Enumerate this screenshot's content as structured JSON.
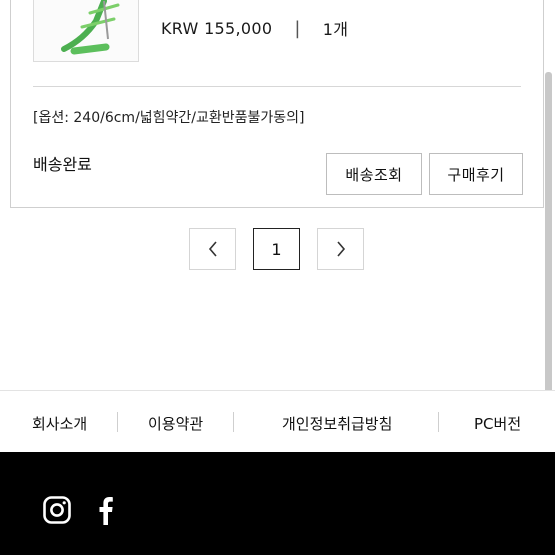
{
  "order": {
    "price": "KRW 155,000",
    "separator": "|",
    "quantity": "1개",
    "option": "[옵션: 240/6cm/넓힘약간/교환반품불가동의]",
    "status": "배송완료",
    "track_label": "배송조회",
    "review_label": "구매후기",
    "product_image": "green-sandal-image"
  },
  "pagination": {
    "prev_icon": "chevron-left-icon",
    "current_page": "1",
    "next_icon": "chevron-right-icon"
  },
  "footer": {
    "links": [
      "회사소개",
      "이용약관",
      "개인정보취급방침",
      "PC버전"
    ],
    "social": [
      "instagram-icon",
      "facebook-icon"
    ]
  }
}
